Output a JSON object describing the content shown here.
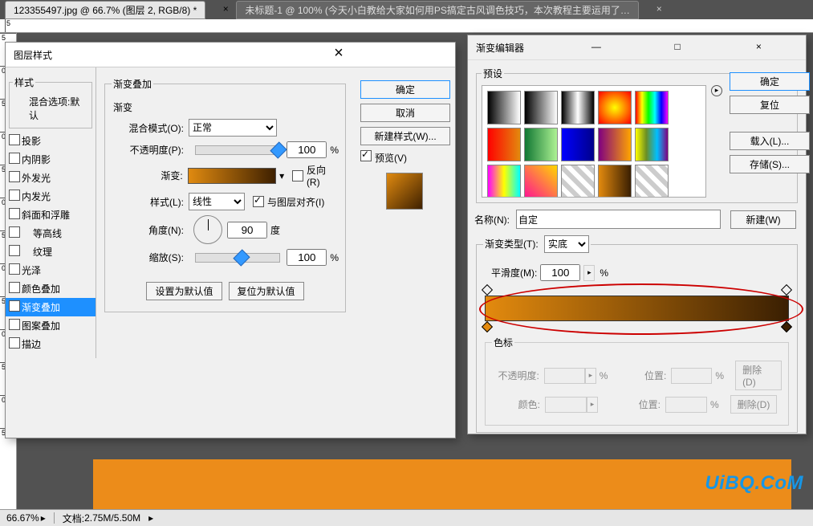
{
  "tabs": {
    "t1": "123355497.jpg @ 66.7% (图层 2, RGB/8) *",
    "t2": "未标题-1 @ 100% (今天小白教给大家如何用PS搞定古风调色技巧，本次教程主要运用了渐变、滤镜以及图层混合模式..."
  },
  "ruler_marks": [
    "5",
    "",
    "",
    "",
    "",
    ""
  ],
  "ruler_v": [
    "5",
    "0",
    "5",
    "0",
    "5",
    "0",
    "5",
    "0",
    "5",
    "0",
    "5",
    "0",
    "5"
  ],
  "layerStyle": {
    "title": "图层样式",
    "stylesLegend": "样式",
    "blendOpts": "混合选项:默认",
    "drop": "投影",
    "inner": "内阴影",
    "outerGlow": "外发光",
    "innerGlow": "内发光",
    "bevel": "斜面和浮雕",
    "contour": "等高线",
    "texture": "纹理",
    "satin": "光泽",
    "colorOverlay": "颜色叠加",
    "gradOverlay": "渐变叠加",
    "patternOverlay": "图案叠加",
    "stroke": "描边",
    "gradLegend": "渐变叠加",
    "gradSub": "渐变",
    "blendMode": "混合模式(O):",
    "blendModeVal": "正常",
    "opacity": "不透明度(P):",
    "opacityVal": "100",
    "pct": "%",
    "gradient": "渐变:",
    "reverse": "反向(R)",
    "style": "样式(L):",
    "styleVal": "线性",
    "alignLayer": "与图层对齐(I)",
    "angle": "角度(N):",
    "angleVal": "90",
    "deg": "度",
    "scale": "缩放(S):",
    "scaleVal": "100",
    "setDefault": "设置为默认值",
    "resetDefault": "复位为默认值",
    "ok": "确定",
    "cancel": "取消",
    "newStyle": "新建样式(W)...",
    "preview": "预览(V)"
  },
  "gradEditor": {
    "title": "渐变编辑器",
    "presetsLegend": "预设",
    "ok": "确定",
    "reset": "复位",
    "load": "载入(L)...",
    "save": "存储(S)...",
    "name": "名称(N):",
    "nameVal": "自定",
    "new": "新建(W)",
    "typeLegend": "渐变类型(T):",
    "typeVal": "实底",
    "smooth": "平滑度(M):",
    "smoothVal": "100",
    "pct": "%",
    "stopsLegend": "色标",
    "opacityL": "不透明度:",
    "locationL": "位置:",
    "colorL": "颜色:",
    "delete": "删除(D)"
  },
  "status": {
    "zoom": "66.67%",
    "doc": "文档:",
    "docVal": "2.75M/5.50M"
  },
  "watermark": "UiBQ.CoM",
  "preset_styles": [
    "linear-gradient(90deg,#000,#fff)",
    "linear-gradient(90deg,#000,transparent)",
    "linear-gradient(90deg,#000,#fff,#000)",
    "radial-gradient(circle,#ff0,#f00)",
    "linear-gradient(90deg,#f00,#ff0,#0f0,#0ff,#00f,#f0f)",
    "linear-gradient(90deg,#f00,#e38a0e)",
    "linear-gradient(90deg,#173,#adf293)",
    "linear-gradient(90deg,#00f,#00008b)",
    "linear-gradient(90deg,#800080,#ffa500)",
    "linear-gradient(90deg,#ffff00,#6b8e23,#00bfff,#800080)",
    "linear-gradient(90deg,#f0f,#ff0,#0ff)",
    "linear-gradient(45deg,#ff1493,#ffd700)",
    "repeating-linear-gradient(45deg,#ccc 0 6px,#fff 6px 12px)",
    "linear-gradient(90deg,#e38a0e,#3a1f02)",
    "repeating-linear-gradient(45deg,#ccc 0 6px,#fff 6px 12px)"
  ]
}
